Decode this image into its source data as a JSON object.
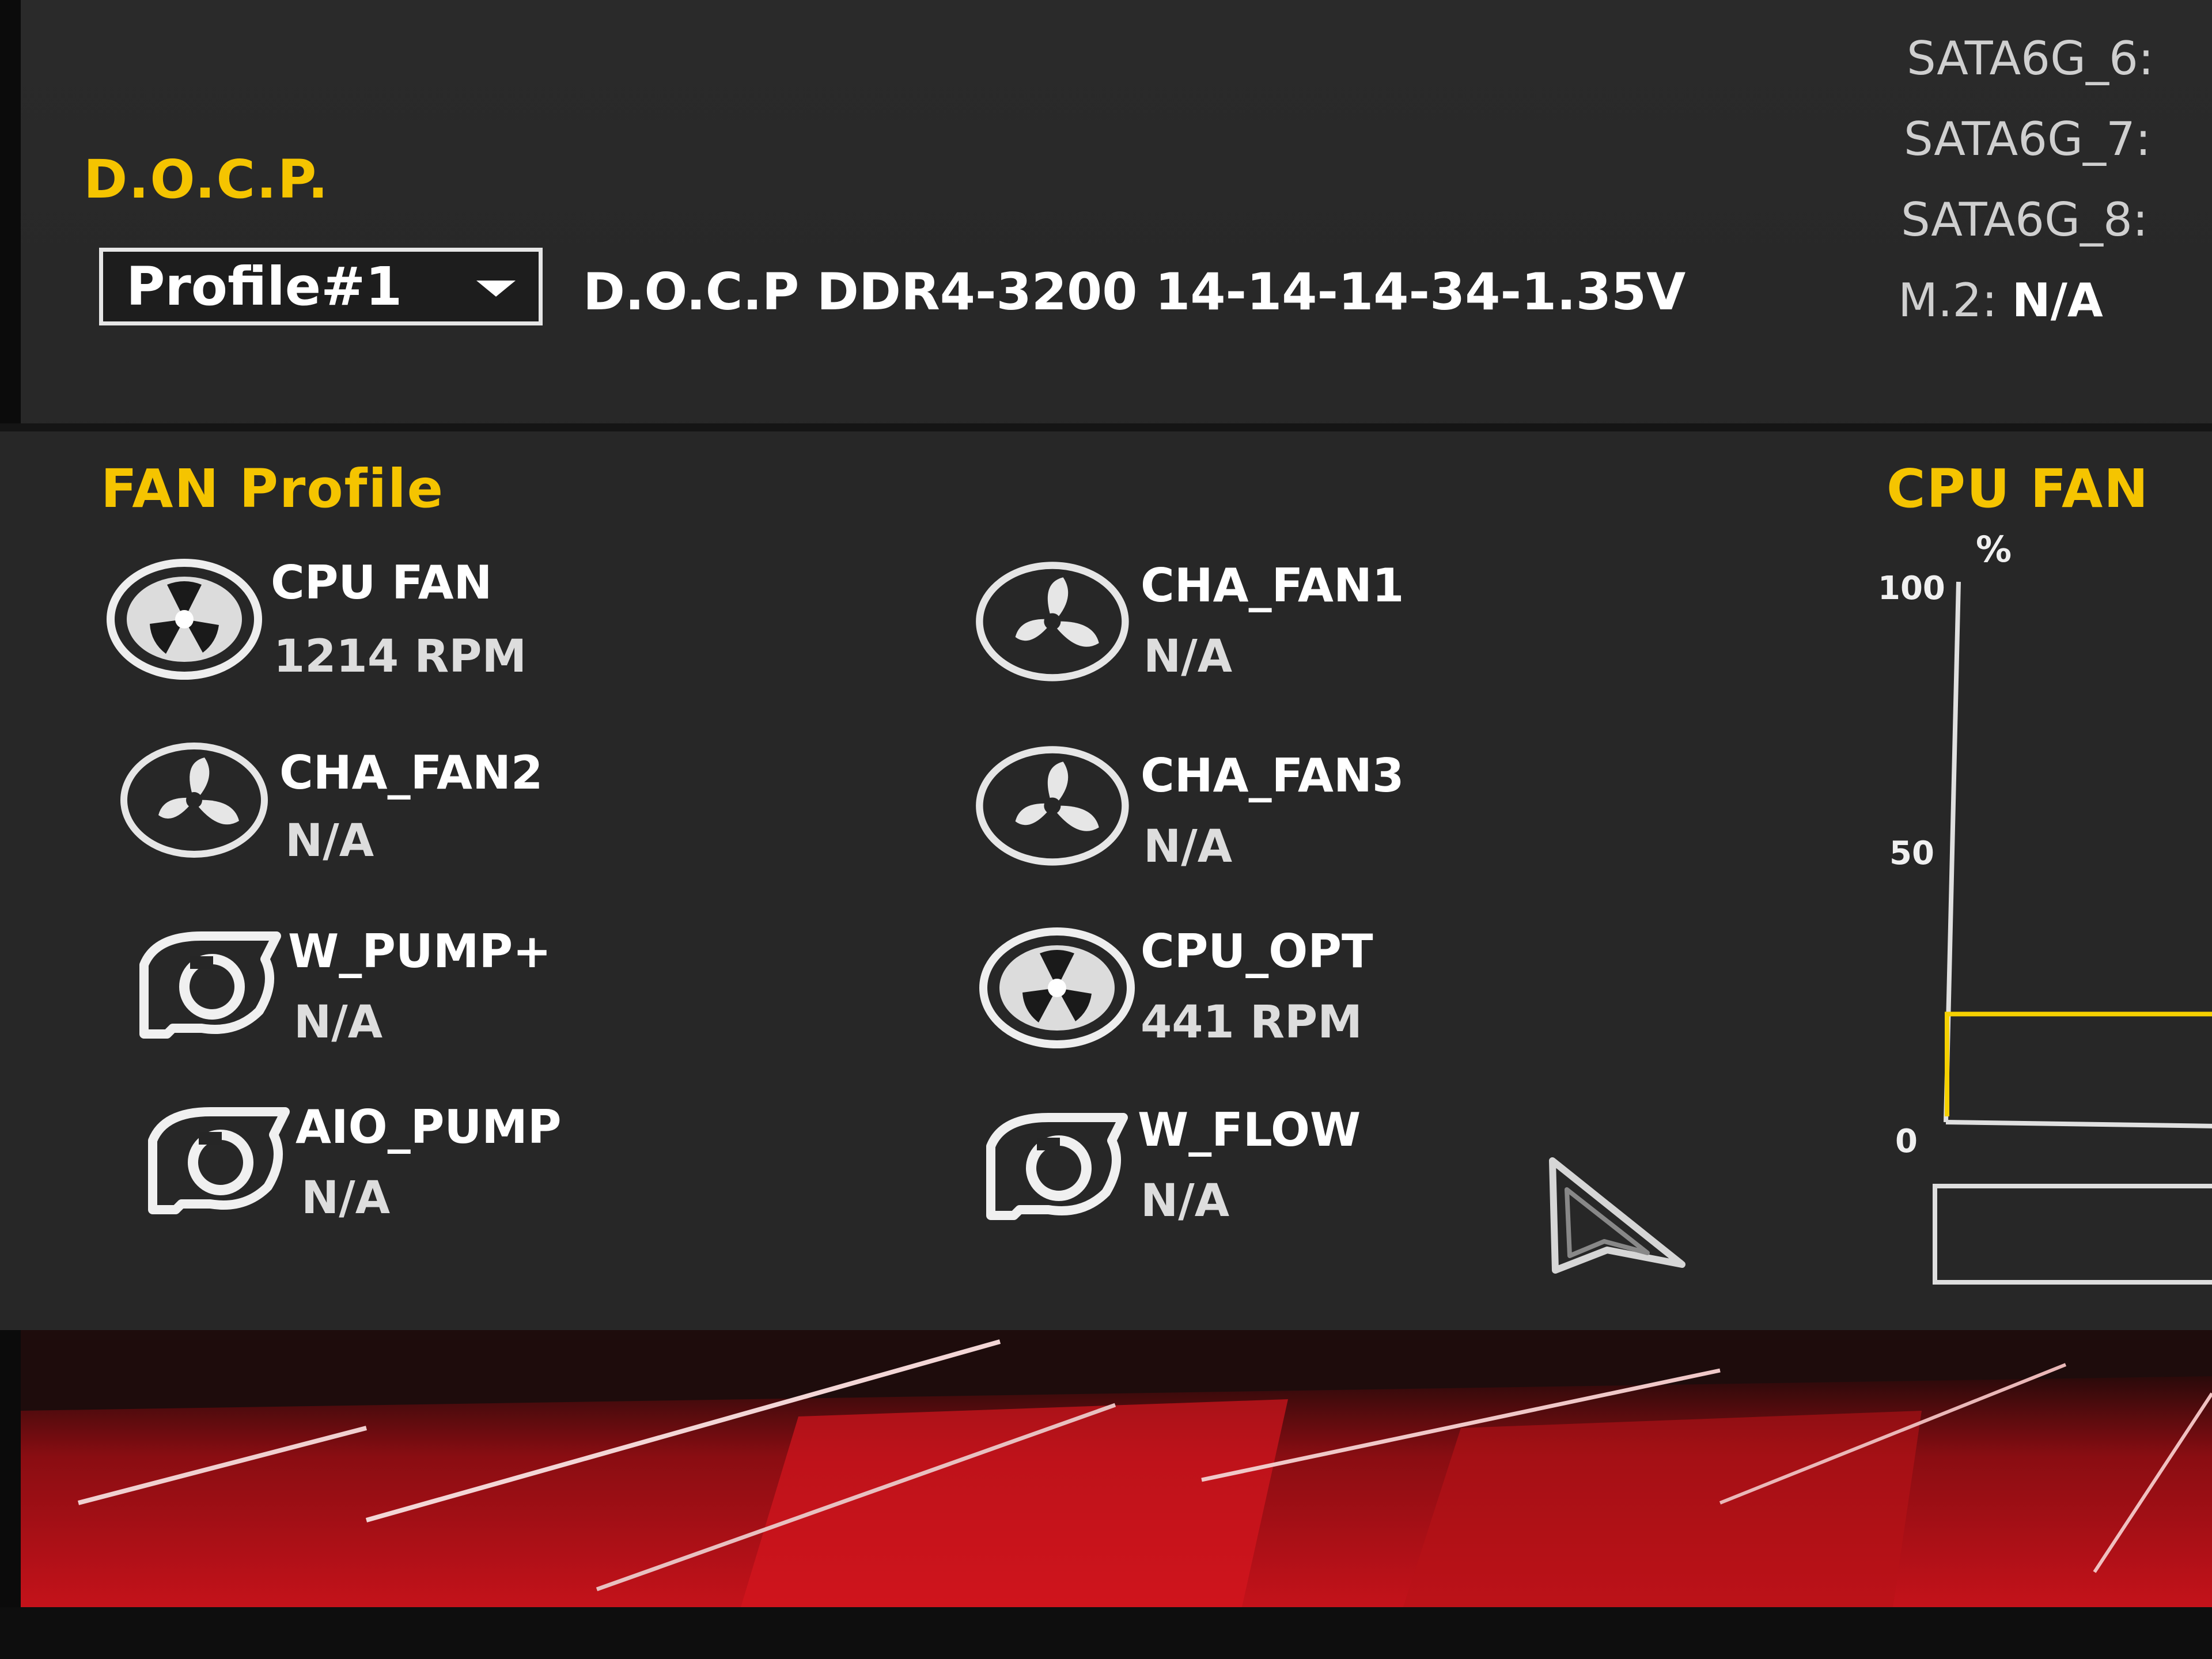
{
  "docp": {
    "title": "D.O.C.P.",
    "profile_selected": "Profile#1",
    "description": "D.O.C.P DDR4-3200 14-14-14-34-1.35V"
  },
  "storage": [
    {
      "label": "SATA6G_6:",
      "value": ""
    },
    {
      "label": "SATA6G_7:",
      "value": ""
    },
    {
      "label": "SATA6G_8:",
      "value": ""
    },
    {
      "label": "M.2:",
      "value": "N/A"
    }
  ],
  "fan_profile": {
    "title": "FAN Profile",
    "fans": [
      {
        "name": "CPU FAN",
        "speed": "1214 RPM",
        "icon": "fan-icon"
      },
      {
        "name": "CHA_FAN1",
        "speed": "N/A",
        "icon": "fan-icon"
      },
      {
        "name": "CHA_FAN2",
        "speed": "N/A",
        "icon": "fan-icon"
      },
      {
        "name": "CHA_FAN3",
        "speed": "N/A",
        "icon": "fan-icon"
      },
      {
        "name": "W_PUMP+",
        "speed": "N/A",
        "icon": "pump-icon"
      },
      {
        "name": "CPU_OPT",
        "speed": "441 RPM",
        "icon": "fan-icon"
      },
      {
        "name": "AIO_PUMP",
        "speed": "N/A",
        "icon": "pump-icon"
      },
      {
        "name": "W_FLOW",
        "speed": "N/A",
        "icon": "pump-icon"
      }
    ]
  },
  "cpu_fan_chart": {
    "title": "CPU FAN",
    "unit": "%",
    "ticks": [
      "100",
      "50",
      "0"
    ],
    "ylim": [
      0,
      100
    ],
    "current_level": 20,
    "colors": {
      "line": "#f5d000",
      "axis": "#e0e0e0"
    }
  },
  "colors": {
    "accent": "#f5c400",
    "background": "#262626",
    "banner_red": "#c4121a"
  }
}
